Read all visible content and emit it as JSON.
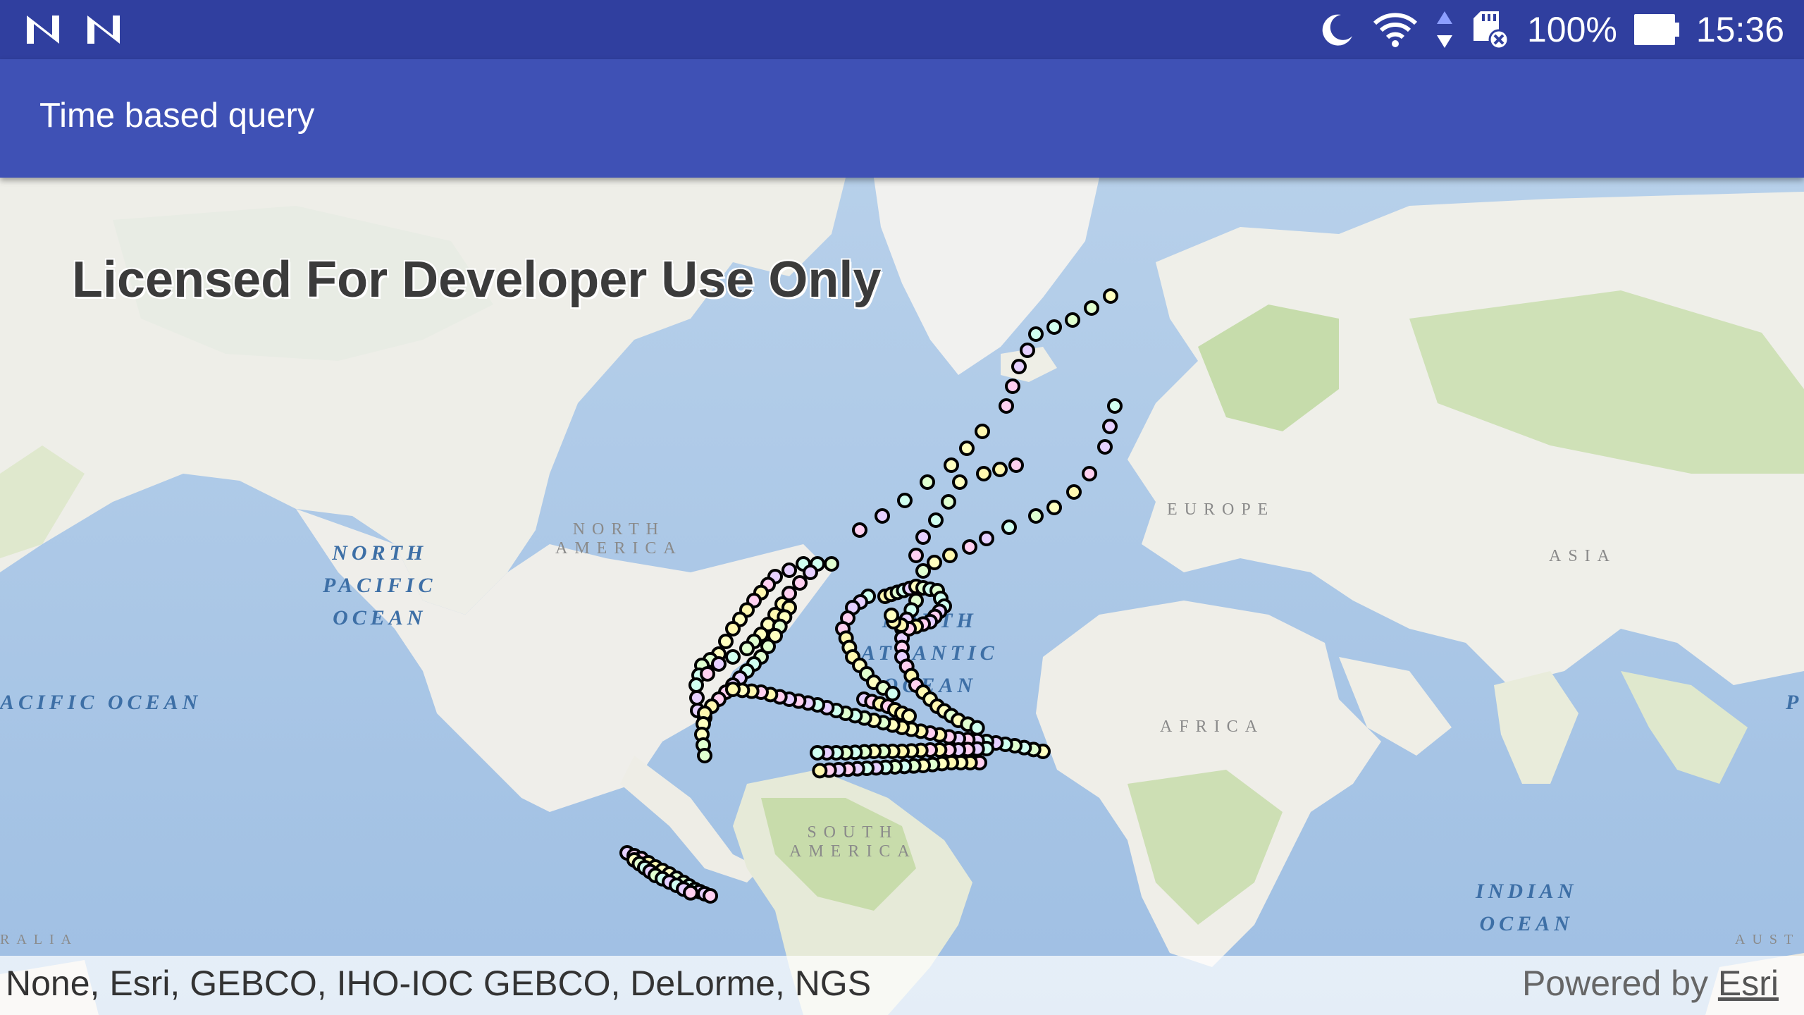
{
  "status_bar": {
    "left_icons": [
      "n-notification-icon",
      "n-notification-icon"
    ],
    "right_icons": [
      "moon-icon",
      "wifi-icon",
      "data-arrows-icon",
      "sd-card-icon"
    ],
    "battery_percent": "100%",
    "time": "15:36"
  },
  "app_bar": {
    "title": "Time based query"
  },
  "map": {
    "watermark": "Licensed For Developer Use Only",
    "labels": {
      "north_america": "NORTH\nAMERICA",
      "south_america": "SOUTH\nAMERICA",
      "europe": "EUROPE",
      "asia": "ASIA",
      "africa": "AFRICA",
      "australia_left": "RALIA",
      "australia_right": "AUST",
      "north_pacific": "NORTH\nPACIFIC\nOCEAN",
      "pacific_left": "ACIFIC OCEAN",
      "pacific_right": "P",
      "north_atlantic": "NORTH\nATLANTIC\nOCEAN",
      "indian": "INDIAN\nOCEAN"
    },
    "attribution": "None, Esri, GEBCO, IHO-IOC GEBCO, DeLorme, NGS",
    "powered_by": "Powered by ",
    "powered_by_link": "Esri"
  },
  "colors": {
    "status_bar": "#303f9f",
    "app_bar": "#3f51b5",
    "ocean": "#a9c6e8",
    "land": "#eeeee8",
    "vegetation": "#c6dcab"
  }
}
